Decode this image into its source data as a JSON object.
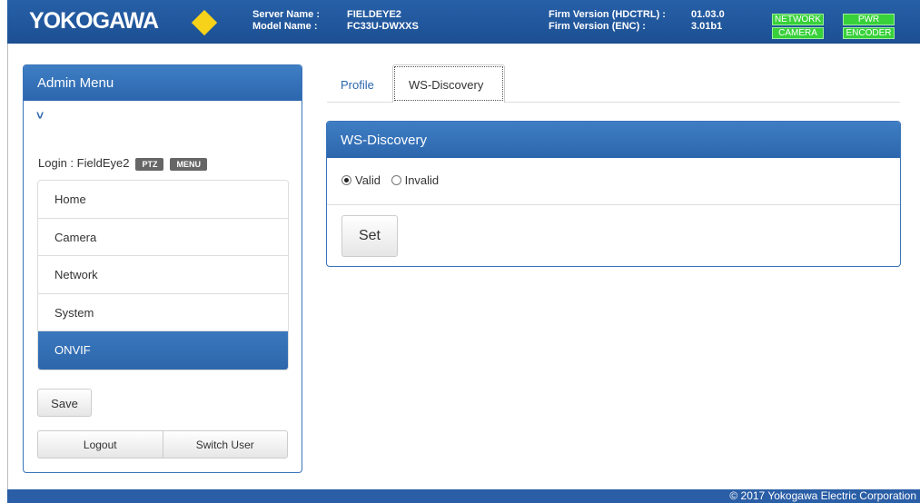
{
  "header": {
    "logo": "YOKOGAWA",
    "server_name_label": "Server Name :",
    "server_name": "FIELDEYE2",
    "model_name_label": "Model Name :",
    "model_name": "FC33U-DWXXS",
    "firm_hdctrl_label": "Firm Version (HDCTRL) :",
    "firm_hdctrl": "01.03.0",
    "firm_enc_label": "Firm Version (ENC) :",
    "firm_enc": "3.01b1",
    "indicators": {
      "network": "NETWORK",
      "pwr": "PWR",
      "camera": "CAMERA",
      "encoder": "ENCODER"
    }
  },
  "sidebar": {
    "title": "Admin Menu",
    "login_text": "Login : FieldEye2",
    "badge_ptz": "PTZ",
    "badge_menu": "MENU",
    "items": [
      {
        "label": "Home"
      },
      {
        "label": "Camera"
      },
      {
        "label": "Network"
      },
      {
        "label": "System"
      },
      {
        "label": "ONVIF"
      }
    ],
    "save_label": "Save",
    "logout_label": "Logout",
    "switch_user_label": "Switch User"
  },
  "tabs": {
    "profile": "Profile",
    "ws_discovery": "WS-Discovery"
  },
  "panel": {
    "title": "WS-Discovery",
    "option_valid": "Valid",
    "option_invalid": "Invalid",
    "selected": "Valid",
    "set_label": "Set"
  },
  "footer": {
    "copyright": "© 2017 Yokogawa Electric Corporation"
  },
  "colors": {
    "header_blue": "#1c4f92",
    "indicator_green": "#38d13a",
    "logo_yellow": "#f7d21a"
  }
}
